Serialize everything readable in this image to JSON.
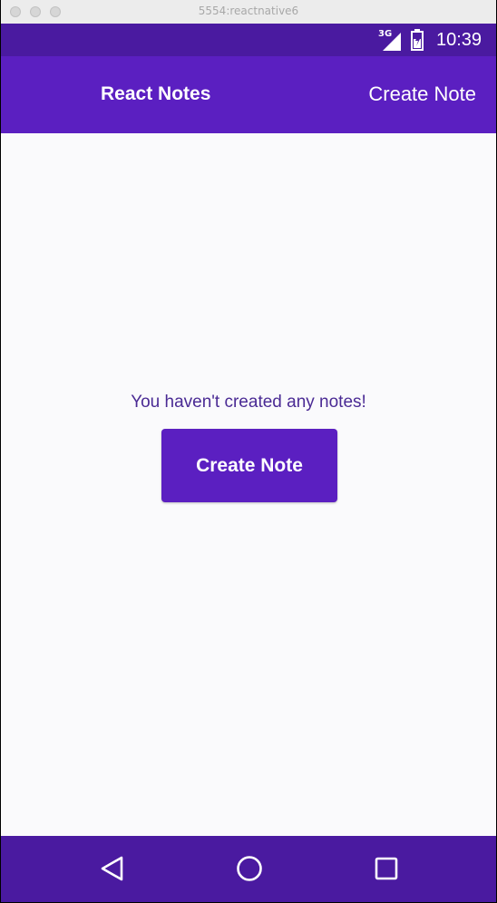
{
  "window": {
    "title": "5554:reactnative6"
  },
  "status_bar": {
    "network_label": "3G",
    "time": "10:39",
    "icons": [
      "signal-icon",
      "battery-icon"
    ]
  },
  "app_bar": {
    "title": "React Notes",
    "action_label": "Create Note"
  },
  "content": {
    "empty_message": "You haven't created any notes!",
    "create_button_label": "Create Note"
  },
  "nav_bar": {
    "icons": [
      "back-icon",
      "home-icon",
      "recents-icon"
    ]
  },
  "colors": {
    "primary": "#5b1fc1",
    "primary_dark": "#4a1aa0",
    "background": "#fafafc",
    "message_text": "#4a2a94"
  }
}
